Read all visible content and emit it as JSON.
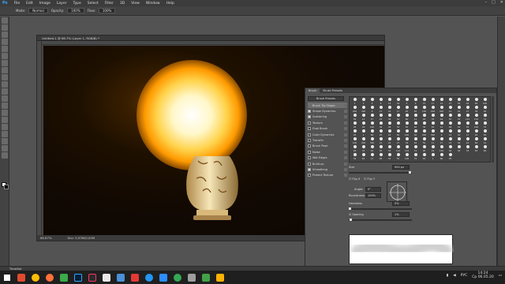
{
  "app": {
    "logo": "Ps",
    "accent": "#31a8ff"
  },
  "menu": [
    "File",
    "Edit",
    "Image",
    "Layer",
    "Type",
    "Select",
    "Filter",
    "3D",
    "View",
    "Window",
    "Help"
  ],
  "options": {
    "mode_label": "Mode:",
    "mode_value": "Normal",
    "opacity_label": "Opacity:",
    "opacity_value": "100%",
    "flow_label": "Flow:",
    "flow_value": "100%"
  },
  "document": {
    "tab_title": "Untitled-1 @ 66.7% (Layer 1, RGB/8) *",
    "zoom": "66.67%",
    "doc_size": "Doc: 5,93M/0,00M"
  },
  "brush_panel": {
    "tabs": [
      "Brush",
      "Brush Presets"
    ],
    "presets_button": "Brush Presets",
    "items": [
      {
        "label": "Brush Tip Shape",
        "checked": false,
        "selected": true
      },
      {
        "label": "Shape Dynamics",
        "checked": true
      },
      {
        "label": "Scattering",
        "checked": true
      },
      {
        "label": "Texture",
        "checked": false
      },
      {
        "label": "Dual Brush",
        "checked": false
      },
      {
        "label": "Color Dynamics",
        "checked": false
      },
      {
        "label": "Transfer",
        "checked": false
      },
      {
        "label": "Brush Pose",
        "checked": false
      },
      {
        "label": "Noise",
        "checked": false
      },
      {
        "label": "Wet Edges",
        "checked": false
      },
      {
        "label": "Build-up",
        "checked": false
      },
      {
        "label": "Smoothing",
        "checked": true
      },
      {
        "label": "Protect Texture",
        "checked": false
      }
    ],
    "sizes": [
      "1",
      "3",
      "5",
      "9",
      "13",
      "19",
      "5",
      "9",
      "13",
      "17",
      "21",
      "27",
      "35",
      "45",
      "65",
      "100",
      "200",
      "300",
      "9",
      "13",
      "19",
      "17",
      "45",
      "65",
      "100",
      "200",
      "300",
      "14",
      "24",
      "27",
      "39",
      "46",
      "59",
      "11",
      "17",
      "23",
      "36",
      "44",
      "60",
      "14",
      "26",
      "33",
      "42",
      "55",
      "70",
      "112",
      "134",
      "74",
      "95",
      "29",
      "192",
      "36",
      "36",
      "33",
      "63",
      "66",
      "39",
      "63",
      "11",
      "48",
      "32",
      "55",
      "100",
      "75",
      "45",
      "1",
      "60",
      "25",
      "23",
      "65",
      "100",
      "40",
      "200",
      "300",
      "9",
      "13",
      "19",
      "17",
      "45",
      "65",
      "100",
      "200",
      "300",
      "14",
      "24",
      "27",
      "39",
      "46",
      "59",
      "11",
      "17",
      "23",
      "36",
      "44",
      "60",
      "14",
      "26",
      "33",
      "42",
      "55",
      "70",
      "112",
      "134",
      "74",
      "95",
      "29",
      "192",
      "36",
      "36",
      "33",
      "63",
      "66",
      "39",
      "63",
      "11",
      "48",
      "32",
      "55",
      "100",
      "75",
      "45",
      "1",
      "60",
      "25"
    ],
    "size_label": "Size",
    "size_value": "900 px",
    "flip_x": "Flip X",
    "flip_y": "Flip Y",
    "angle_label": "Angle:",
    "angle_value": "0°",
    "roundness_label": "Roundness:",
    "roundness_value": "100%",
    "hardness_label": "Hardness",
    "hardness_value": "0%",
    "spacing_label": "Spacing",
    "spacing_value": "1%"
  },
  "timeline_label": "Timeline",
  "tray": {
    "lang": "РУС",
    "time": "14:24",
    "date": "Ср 06.05.20"
  }
}
